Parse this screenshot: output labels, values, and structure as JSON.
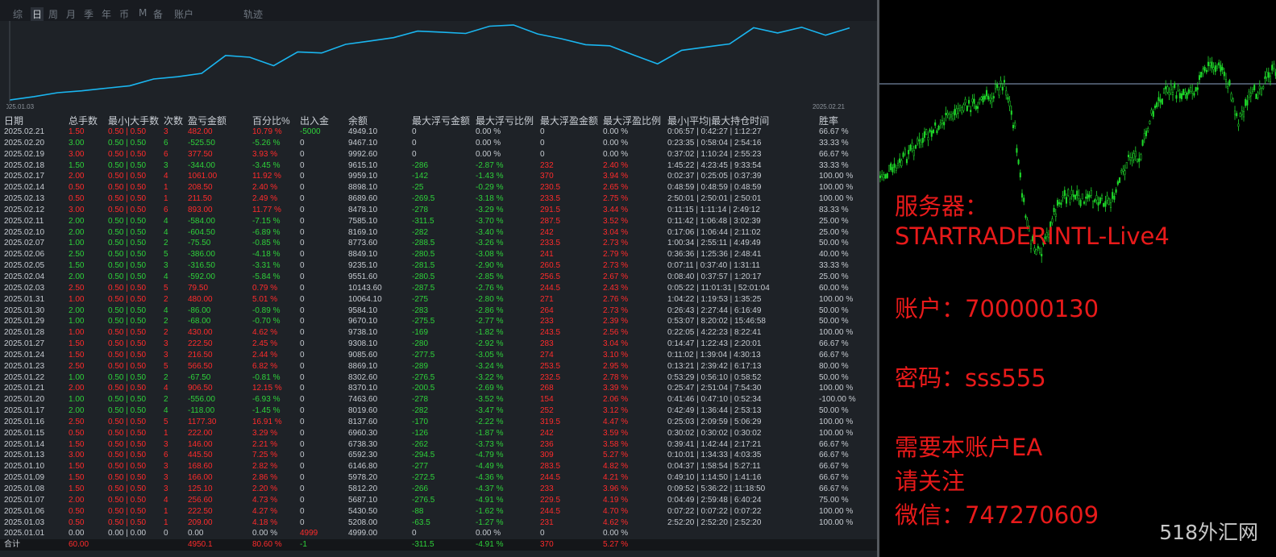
{
  "tabs": [
    "综",
    "日",
    "周",
    "月",
    "季",
    "年",
    "币",
    "M",
    "备",
    "账户",
    "轨迹"
  ],
  "active_tab": "日",
  "equity_chart": {
    "start_label": "2025.01.03",
    "end_label": "2025.02.21",
    "line_color": "#1ab6f0",
    "values": [
      5208.0,
      5430.5,
      5687.1,
      5812.2,
      5978.2,
      6146.8,
      6592.3,
      6738.3,
      6960.3,
      8137.6,
      8019.6,
      7463.6,
      8370.1,
      8302.6,
      8869.1,
      9085.6,
      9308.1,
      9738.1,
      9670.1,
      9584.1,
      10064.1,
      10143.6,
      9551.6,
      9235.1,
      8849.1,
      8773.6,
      8169.1,
      7585.1,
      8478.1,
      8689.6,
      8898.1,
      9959.1,
      9615.1,
      9992.6,
      9467.1,
      9949.1
    ]
  },
  "columns": [
    "日期",
    "总手数",
    "最小|大手数",
    "次数",
    "盈亏金额",
    "百分比%",
    "出入金",
    "余额",
    "最大浮亏金额",
    "最大浮亏比例",
    "最大浮盈金额",
    "最大浮盈比例",
    "最小|平均|最大持仓时间",
    "胜率"
  ],
  "rows": [
    {
      "date": "2025.02.21",
      "lots": "1.50",
      "minmax": "0.50 | 0.50",
      "count": "3",
      "pnl": "482.00",
      "pct": "10.79 %",
      "cash": "-5000",
      "balance": "4949.10",
      "fl_amt": "0",
      "fl_pct": "0.00 %",
      "fp_amt": "0",
      "fp_pct": "0.00 %",
      "hold": "0:06:57 | 0:42:27 | 1:12:27",
      "win": "66.67 %",
      "s": "pos"
    },
    {
      "date": "2025.02.20",
      "lots": "3.00",
      "minmax": "0.50 | 0.50",
      "count": "6",
      "pnl": "-525.50",
      "pct": "-5.26 %",
      "cash": "0",
      "balance": "9467.10",
      "fl_amt": "0",
      "fl_pct": "0.00 %",
      "fp_amt": "0",
      "fp_pct": "0.00 %",
      "hold": "0:23:35 | 0:58:04 | 2:54:16",
      "win": "33.33 %",
      "s": "neg"
    },
    {
      "date": "2025.02.19",
      "lots": "3.00",
      "minmax": "0.50 | 0.50",
      "count": "6",
      "pnl": "377.50",
      "pct": "3.93 %",
      "cash": "0",
      "balance": "9992.60",
      "fl_amt": "0",
      "fl_pct": "0.00 %",
      "fp_amt": "0",
      "fp_pct": "0.00 %",
      "hold": "0:37:02 | 1:10:24 | 2:55:23",
      "win": "66.67 %",
      "s": "pos"
    },
    {
      "date": "2025.02.18",
      "lots": "1.50",
      "minmax": "0.50 | 0.50",
      "count": "3",
      "pnl": "-344.00",
      "pct": "-3.45 %",
      "cash": "0",
      "balance": "9615.10",
      "fl_amt": "-286",
      "fl_pct": "-2.87 %",
      "fp_amt": "232",
      "fp_pct": "2.40 %",
      "hold": "1:45:22 | 4:23:45 | 9:33:54",
      "win": "33.33 %",
      "s": "neg"
    },
    {
      "date": "2025.02.17",
      "lots": "2.00",
      "minmax": "0.50 | 0.50",
      "count": "4",
      "pnl": "1061.00",
      "pct": "11.92 %",
      "cash": "0",
      "balance": "9959.10",
      "fl_amt": "-142",
      "fl_pct": "-1.43 %",
      "fp_amt": "370",
      "fp_pct": "3.94 %",
      "hold": "0:02:37 | 0:25:05 | 0:37:39",
      "win": "100.00 %",
      "s": "pos"
    },
    {
      "date": "2025.02.14",
      "lots": "0.50",
      "minmax": "0.50 | 0.50",
      "count": "1",
      "pnl": "208.50",
      "pct": "2.40 %",
      "cash": "0",
      "balance": "8898.10",
      "fl_amt": "-25",
      "fl_pct": "-0.29 %",
      "fp_amt": "230.5",
      "fp_pct": "2.65 %",
      "hold": "0:48:59 | 0:48:59 | 0:48:59",
      "win": "100.00 %",
      "s": "pos"
    },
    {
      "date": "2025.02.13",
      "lots": "0.50",
      "minmax": "0.50 | 0.50",
      "count": "1",
      "pnl": "211.50",
      "pct": "2.49 %",
      "cash": "0",
      "balance": "8689.60",
      "fl_amt": "-269.5",
      "fl_pct": "-3.18 %",
      "fp_amt": "233.5",
      "fp_pct": "2.75 %",
      "hold": "2:50:01 | 2:50:01 | 2:50:01",
      "win": "100.00 %",
      "s": "pos"
    },
    {
      "date": "2025.02.12",
      "lots": "3.00",
      "minmax": "0.50 | 0.50",
      "count": "6",
      "pnl": "893.00",
      "pct": "11.77 %",
      "cash": "0",
      "balance": "8478.10",
      "fl_amt": "-278",
      "fl_pct": "-3.29 %",
      "fp_amt": "291.5",
      "fp_pct": "3.44 %",
      "hold": "0:11:15 | 1:11:14 | 2:49:12",
      "win": "83.33 %",
      "s": "pos"
    },
    {
      "date": "2025.02.11",
      "lots": "2.00",
      "minmax": "0.50 | 0.50",
      "count": "4",
      "pnl": "-584.00",
      "pct": "-7.15 %",
      "cash": "0",
      "balance": "7585.10",
      "fl_amt": "-311.5",
      "fl_pct": "-3.70 %",
      "fp_amt": "287.5",
      "fp_pct": "3.52 %",
      "hold": "0:11:42 | 1:06:48 | 3:02:39",
      "win": "25.00 %",
      "s": "neg"
    },
    {
      "date": "2025.02.10",
      "lots": "2.00",
      "minmax": "0.50 | 0.50",
      "count": "4",
      "pnl": "-604.50",
      "pct": "-6.89 %",
      "cash": "0",
      "balance": "8169.10",
      "fl_amt": "-282",
      "fl_pct": "-3.40 %",
      "fp_amt": "242",
      "fp_pct": "3.04 %",
      "hold": "0:17:06 | 1:06:44 | 2:11:02",
      "win": "25.00 %",
      "s": "neg"
    },
    {
      "date": "2025.02.07",
      "lots": "1.00",
      "minmax": "0.50 | 0.50",
      "count": "2",
      "pnl": "-75.50",
      "pct": "-0.85 %",
      "cash": "0",
      "balance": "8773.60",
      "fl_amt": "-288.5",
      "fl_pct": "-3.26 %",
      "fp_amt": "233.5",
      "fp_pct": "2.73 %",
      "hold": "1:00:34 | 2:55:11 | 4:49:49",
      "win": "50.00 %",
      "s": "neg"
    },
    {
      "date": "2025.02.06",
      "lots": "2.50",
      "minmax": "0.50 | 0.50",
      "count": "5",
      "pnl": "-386.00",
      "pct": "-4.18 %",
      "cash": "0",
      "balance": "8849.10",
      "fl_amt": "-280.5",
      "fl_pct": "-3.08 %",
      "fp_amt": "241",
      "fp_pct": "2.79 %",
      "hold": "0:36:36 | 1:25:36 | 2:48:41",
      "win": "40.00 %",
      "s": "neg"
    },
    {
      "date": "2025.02.05",
      "lots": "1.50",
      "minmax": "0.50 | 0.50",
      "count": "3",
      "pnl": "-316.50",
      "pct": "-3.31 %",
      "cash": "0",
      "balance": "9235.10",
      "fl_amt": "-281.5",
      "fl_pct": "-2.90 %",
      "fp_amt": "260.5",
      "fp_pct": "2.73 %",
      "hold": "0:07:11 | 0:37:40 | 1:31:11",
      "win": "33.33 %",
      "s": "neg"
    },
    {
      "date": "2025.02.04",
      "lots": "2.00",
      "minmax": "0.50 | 0.50",
      "count": "4",
      "pnl": "-592.00",
      "pct": "-5.84 %",
      "cash": "0",
      "balance": "9551.60",
      "fl_amt": "-280.5",
      "fl_pct": "-2.85 %",
      "fp_amt": "256.5",
      "fp_pct": "2.67 %",
      "hold": "0:08:40 | 0:37:57 | 1:20:17",
      "win": "25.00 %",
      "s": "neg"
    },
    {
      "date": "2025.02.03",
      "lots": "2.50",
      "minmax": "0.50 | 0.50",
      "count": "5",
      "pnl": "79.50",
      "pct": "0.79 %",
      "cash": "0",
      "balance": "10143.60",
      "fl_amt": "-287.5",
      "fl_pct": "-2.76 %",
      "fp_amt": "244.5",
      "fp_pct": "2.43 %",
      "hold": "0:05:22 | 11:01:31 | 52:01:04",
      "win": "60.00 %",
      "s": "pos"
    },
    {
      "date": "2025.01.31",
      "lots": "1.00",
      "minmax": "0.50 | 0.50",
      "count": "2",
      "pnl": "480.00",
      "pct": "5.01 %",
      "cash": "0",
      "balance": "10064.10",
      "fl_amt": "-275",
      "fl_pct": "-2.80 %",
      "fp_amt": "271",
      "fp_pct": "2.76 %",
      "hold": "1:04:22 | 1:19:53 | 1:35:25",
      "win": "100.00 %",
      "s": "pos"
    },
    {
      "date": "2025.01.30",
      "lots": "2.00",
      "minmax": "0.50 | 0.50",
      "count": "4",
      "pnl": "-86.00",
      "pct": "-0.89 %",
      "cash": "0",
      "balance": "9584.10",
      "fl_amt": "-283",
      "fl_pct": "-2.86 %",
      "fp_amt": "264",
      "fp_pct": "2.73 %",
      "hold": "0:26:43 | 2:27:44 | 6:16:49",
      "win": "50.00 %",
      "s": "neg"
    },
    {
      "date": "2025.01.29",
      "lots": "1.00",
      "minmax": "0.50 | 0.50",
      "count": "2",
      "pnl": "-68.00",
      "pct": "-0.70 %",
      "cash": "0",
      "balance": "9670.10",
      "fl_amt": "-275.5",
      "fl_pct": "-2.77 %",
      "fp_amt": "233",
      "fp_pct": "2.39 %",
      "hold": "0:53:07 | 8:20:02 | 15:46:58",
      "win": "50.00 %",
      "s": "neg"
    },
    {
      "date": "2025.01.28",
      "lots": "1.00",
      "minmax": "0.50 | 0.50",
      "count": "2",
      "pnl": "430.00",
      "pct": "4.62 %",
      "cash": "0",
      "balance": "9738.10",
      "fl_amt": "-169",
      "fl_pct": "-1.82 %",
      "fp_amt": "243.5",
      "fp_pct": "2.56 %",
      "hold": "0:22:05 | 4:22:23 | 8:22:41",
      "win": "100.00 %",
      "s": "pos"
    },
    {
      "date": "2025.01.27",
      "lots": "1.50",
      "minmax": "0.50 | 0.50",
      "count": "3",
      "pnl": "222.50",
      "pct": "2.45 %",
      "cash": "0",
      "balance": "9308.10",
      "fl_amt": "-280",
      "fl_pct": "-2.92 %",
      "fp_amt": "283",
      "fp_pct": "3.04 %",
      "hold": "0:14:47 | 1:22:43 | 2:20:01",
      "win": "66.67 %",
      "s": "pos"
    },
    {
      "date": "2025.01.24",
      "lots": "1.50",
      "minmax": "0.50 | 0.50",
      "count": "3",
      "pnl": "216.50",
      "pct": "2.44 %",
      "cash": "0",
      "balance": "9085.60",
      "fl_amt": "-277.5",
      "fl_pct": "-3.05 %",
      "fp_amt": "274",
      "fp_pct": "3.10 %",
      "hold": "0:11:02 | 1:39:04 | 4:30:13",
      "win": "66.67 %",
      "s": "pos"
    },
    {
      "date": "2025.01.23",
      "lots": "2.50",
      "minmax": "0.50 | 0.50",
      "count": "5",
      "pnl": "566.50",
      "pct": "6.82 %",
      "cash": "0",
      "balance": "8869.10",
      "fl_amt": "-289",
      "fl_pct": "-3.24 %",
      "fp_amt": "253.5",
      "fp_pct": "2.95 %",
      "hold": "0:13:21 | 2:39:42 | 6:17:13",
      "win": "80.00 %",
      "s": "pos"
    },
    {
      "date": "2025.01.22",
      "lots": "1.00",
      "minmax": "0.50 | 0.50",
      "count": "2",
      "pnl": "-67.50",
      "pct": "-0.81 %",
      "cash": "0",
      "balance": "8302.60",
      "fl_amt": "-276.5",
      "fl_pct": "-3.22 %",
      "fp_amt": "232.5",
      "fp_pct": "2.78 %",
      "hold": "0:53:29 | 0:56:10 | 0:58:52",
      "win": "50.00 %",
      "s": "neg"
    },
    {
      "date": "2025.01.21",
      "lots": "2.00",
      "minmax": "0.50 | 0.50",
      "count": "4",
      "pnl": "906.50",
      "pct": "12.15 %",
      "cash": "0",
      "balance": "8370.10",
      "fl_amt": "-200.5",
      "fl_pct": "-2.69 %",
      "fp_amt": "268",
      "fp_pct": "3.39 %",
      "hold": "0:25:47 | 2:51:04 | 7:54:30",
      "win": "100.00 %",
      "s": "pos"
    },
    {
      "date": "2025.01.20",
      "lots": "1.00",
      "minmax": "0.50 | 0.50",
      "count": "2",
      "pnl": "-556.00",
      "pct": "-6.93 %",
      "cash": "0",
      "balance": "7463.60",
      "fl_amt": "-278",
      "fl_pct": "-3.52 %",
      "fp_amt": "154",
      "fp_pct": "2.06 %",
      "hold": "0:41:46 | 0:47:10 | 0:52:34",
      "win": "-100.00 %",
      "s": "neg"
    },
    {
      "date": "2025.01.17",
      "lots": "2.00",
      "minmax": "0.50 | 0.50",
      "count": "4",
      "pnl": "-118.00",
      "pct": "-1.45 %",
      "cash": "0",
      "balance": "8019.60",
      "fl_amt": "-282",
      "fl_pct": "-3.47 %",
      "fp_amt": "252",
      "fp_pct": "3.12 %",
      "hold": "0:42:49 | 1:36:44 | 2:53:13",
      "win": "50.00 %",
      "s": "neg"
    },
    {
      "date": "2025.01.16",
      "lots": "2.50",
      "minmax": "0.50 | 0.50",
      "count": "5",
      "pnl": "1177.30",
      "pct": "16.91 %",
      "cash": "0",
      "balance": "8137.60",
      "fl_amt": "-170",
      "fl_pct": "-2.22 %",
      "fp_amt": "319.5",
      "fp_pct": "4.47 %",
      "hold": "0:25:03 | 2:09:59 | 5:06:29",
      "win": "100.00 %",
      "s": "pos"
    },
    {
      "date": "2025.01.15",
      "lots": "0.50",
      "minmax": "0.50 | 0.50",
      "count": "1",
      "pnl": "222.00",
      "pct": "3.29 %",
      "cash": "0",
      "balance": "6960.30",
      "fl_amt": "-126",
      "fl_pct": "-1.87 %",
      "fp_amt": "242",
      "fp_pct": "3.59 %",
      "hold": "0:30:02 | 0:30:02 | 0:30:02",
      "win": "100.00 %",
      "s": "pos"
    },
    {
      "date": "2025.01.14",
      "lots": "1.50",
      "minmax": "0.50 | 0.50",
      "count": "3",
      "pnl": "146.00",
      "pct": "2.21 %",
      "cash": "0",
      "balance": "6738.30",
      "fl_amt": "-262",
      "fl_pct": "-3.73 %",
      "fp_amt": "236",
      "fp_pct": "3.58 %",
      "hold": "0:39:41 | 1:42:44 | 2:17:21",
      "win": "66.67 %",
      "s": "pos"
    },
    {
      "date": "2025.01.13",
      "lots": "3.00",
      "minmax": "0.50 | 0.50",
      "count": "6",
      "pnl": "445.50",
      "pct": "7.25 %",
      "cash": "0",
      "balance": "6592.30",
      "fl_amt": "-294.5",
      "fl_pct": "-4.79 %",
      "fp_amt": "309",
      "fp_pct": "5.27 %",
      "hold": "0:10:01 | 1:34:33 | 4:03:35",
      "win": "66.67 %",
      "s": "pos"
    },
    {
      "date": "2025.01.10",
      "lots": "1.50",
      "minmax": "0.50 | 0.50",
      "count": "3",
      "pnl": "168.60",
      "pct": "2.82 %",
      "cash": "0",
      "balance": "6146.80",
      "fl_amt": "-277",
      "fl_pct": "-4.49 %",
      "fp_amt": "283.5",
      "fp_pct": "4.82 %",
      "hold": "0:04:37 | 1:58:54 | 5:27:11",
      "win": "66.67 %",
      "s": "pos"
    },
    {
      "date": "2025.01.09",
      "lots": "1.50",
      "minmax": "0.50 | 0.50",
      "count": "3",
      "pnl": "166.00",
      "pct": "2.86 %",
      "cash": "0",
      "balance": "5978.20",
      "fl_amt": "-272.5",
      "fl_pct": "-4.36 %",
      "fp_amt": "244.5",
      "fp_pct": "4.21 %",
      "hold": "0:49:10 | 1:14:50 | 1:41:16",
      "win": "66.67 %",
      "s": "pos"
    },
    {
      "date": "2025.01.08",
      "lots": "1.50",
      "minmax": "0.50 | 0.50",
      "count": "3",
      "pnl": "125.10",
      "pct": "2.20 %",
      "cash": "0",
      "balance": "5812.20",
      "fl_amt": "-266",
      "fl_pct": "-4.37 %",
      "fp_amt": "233",
      "fp_pct": "3.96 %",
      "hold": "0:09:52 | 5:36:22 | 11:18:50",
      "win": "66.67 %",
      "s": "pos"
    },
    {
      "date": "2025.01.07",
      "lots": "2.00",
      "minmax": "0.50 | 0.50",
      "count": "4",
      "pnl": "256.60",
      "pct": "4.73 %",
      "cash": "0",
      "balance": "5687.10",
      "fl_amt": "-276.5",
      "fl_pct": "-4.91 %",
      "fp_amt": "229.5",
      "fp_pct": "4.19 %",
      "hold": "0:04:49 | 2:59:48 | 6:40:24",
      "win": "75.00 %",
      "s": "pos"
    },
    {
      "date": "2025.01.06",
      "lots": "0.50",
      "minmax": "0.50 | 0.50",
      "count": "1",
      "pnl": "222.50",
      "pct": "4.27 %",
      "cash": "0",
      "balance": "5430.50",
      "fl_amt": "-88",
      "fl_pct": "-1.62 %",
      "fp_amt": "244.5",
      "fp_pct": "4.70 %",
      "hold": "0:07:22 | 0:07:22 | 0:07:22",
      "win": "100.00 %",
      "s": "pos"
    },
    {
      "date": "2025.01.03",
      "lots": "0.50",
      "minmax": "0.50 | 0.50",
      "count": "1",
      "pnl": "209.00",
      "pct": "4.18 %",
      "cash": "0",
      "balance": "5208.00",
      "fl_amt": "-63.5",
      "fl_pct": "-1.27 %",
      "fp_amt": "231",
      "fp_pct": "4.62 %",
      "hold": "2:52:20 | 2:52:20 | 2:52:20",
      "win": "100.00 %",
      "s": "pos"
    },
    {
      "date": "2025.01.01",
      "lots": "0.00",
      "minmax": "0.00 | 0.00",
      "count": "0",
      "pnl": "0.00",
      "pct": "0.00 %",
      "cash": "4999",
      "balance": "4999.00",
      "fl_amt": "0",
      "fl_pct": "0.00 %",
      "fp_amt": "0",
      "fp_pct": "0.00 %",
      "hold": "",
      "win": "",
      "s": "neu"
    }
  ],
  "total": {
    "label": "合计",
    "lots": "60.00",
    "pnl": "4950.1",
    "pct": "80.60 %",
    "cash": "-1",
    "fl_amt": "-311.5",
    "fl_pct": "-4.91 %",
    "fp_amt": "370",
    "fp_pct": "5.27 %"
  },
  "info_lines": [
    "服务器：",
    "STARTRADERINTL-Live4",
    "",
    "账户：700000130",
    "",
    "密码：sss555",
    "",
    "需要本账户EA",
    "请关注",
    "微信：747270609"
  ],
  "watermark": "518外汇网",
  "colors": {
    "profit": "#ff2b2b",
    "loss": "#2ed13a",
    "candle": "#1ed82a",
    "price_line": "#8fa6c8",
    "info_text": "#e81a1a"
  }
}
